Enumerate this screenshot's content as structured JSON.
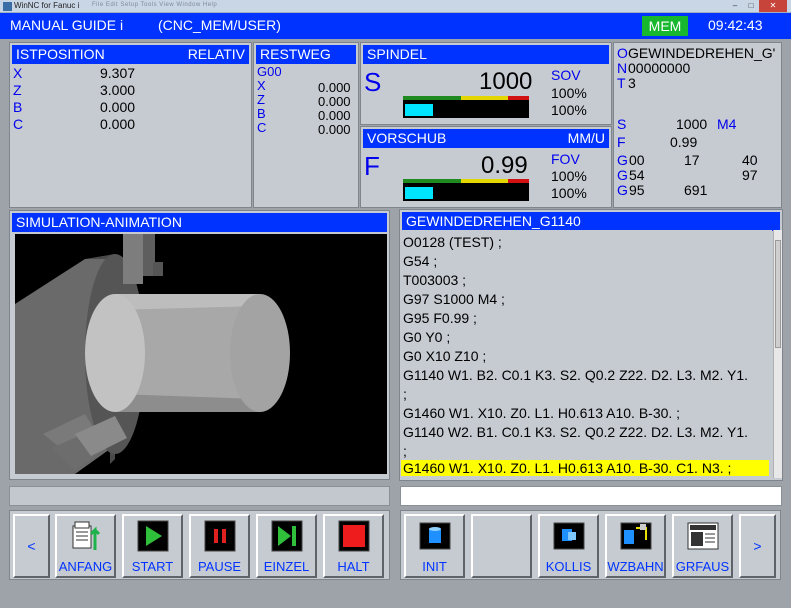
{
  "window": {
    "title": "WinNC for Fanuc i",
    "menus": [
      "File",
      "Edit",
      "Setup",
      "Tools",
      "View",
      "Window",
      "Help"
    ]
  },
  "header": {
    "mode": "MANUAL GUIDE i",
    "path": "(CNC_MEM/USER)",
    "mem_badge": "MEM",
    "clock": "09:42:43"
  },
  "ist": {
    "title": "ISTPOSITION",
    "title_right": "RELATIV",
    "rows": [
      {
        "axis": "X",
        "value": "9.307"
      },
      {
        "axis": "Z",
        "value": "3.000"
      },
      {
        "axis": "B",
        "value": "0.000"
      },
      {
        "axis": "C",
        "value": "0.000"
      }
    ]
  },
  "rest": {
    "title": "RESTWEG",
    "gcode": "G00",
    "rows": [
      {
        "axis": "X",
        "value": "0.000"
      },
      {
        "axis": "Z",
        "value": "0.000"
      },
      {
        "axis": "B",
        "value": "0.000"
      },
      {
        "axis": "C",
        "value": "0.000"
      }
    ]
  },
  "spindel": {
    "title": "SPINDEL",
    "letter": "S",
    "value": "1000",
    "override_label": "SOV",
    "ov1": "100%",
    "ov2": "100%",
    "load_fraction": 0.23
  },
  "vorschub": {
    "title": "VORSCHUB",
    "unit": "MM/U",
    "letter": "F",
    "value": "0.99",
    "override_label": "FOV",
    "ov1": "100%",
    "ov2": "100%",
    "load_fraction": 0.23
  },
  "info": {
    "o_label": "O",
    "o_value": "GEWINDEDREHEN_G'",
    "n_label": "N",
    "n_value": "00000000",
    "t_label": "T",
    "t_value": "3",
    "s_label": "S",
    "s_value": "1000",
    "m_value": "M4",
    "f_label": "F",
    "f_value": "0.99",
    "g_rows": [
      {
        "g": "G",
        "code": "00",
        "a": "17",
        "b": "40"
      },
      {
        "g": "G",
        "code": "54",
        "a": "",
        "b": "97"
      },
      {
        "g": "G",
        "code": "95",
        "a": "691",
        "b": ""
      }
    ]
  },
  "sim": {
    "title": "SIMULATION-ANIMATION"
  },
  "program": {
    "title": "GEWINDEDREHEN_G1140",
    "lines": [
      "O0128 (TEST) ;",
      "G54 ;",
      "T003003 ;",
      "G97 S1000 M4 ;",
      "G95 F0.99 ;",
      "G0 Y0 ;",
      "G0 X10 Z10 ;",
      "G1140 W1. B2. C0.1 K3. S2. Q0.2 Z22. D2. L3. M2. Y1.",
      ";",
      "G1460 W1. X10. Z0. L1. H0.613 A10. B-30. ;",
      "G1140 W2. B1. C0.1 K3. S2. Q0.2 Z22. D2. L3. M2. Y1.",
      ";",
      "G1460 W1. X10. Z0. L1. H0.613 A10. B-30. C1. N3. ;"
    ]
  },
  "softkeys_left": {
    "prev": "<",
    "anfang": "ANFANG",
    "start": "START",
    "pause": "PAUSE",
    "einzel": "EINZEL",
    "halt": "HALT"
  },
  "softkeys_right": {
    "init": "INIT",
    "kollis": "KOLLIS",
    "wzbahn": "WZBAHN",
    "grfaus": "GRFAUS",
    "next": ">"
  },
  "colors": {
    "title_blue": "#0033ff",
    "mem_green": "#17b82e",
    "highlight": "#ffff00",
    "panel_grey": "#c6cbd2"
  }
}
